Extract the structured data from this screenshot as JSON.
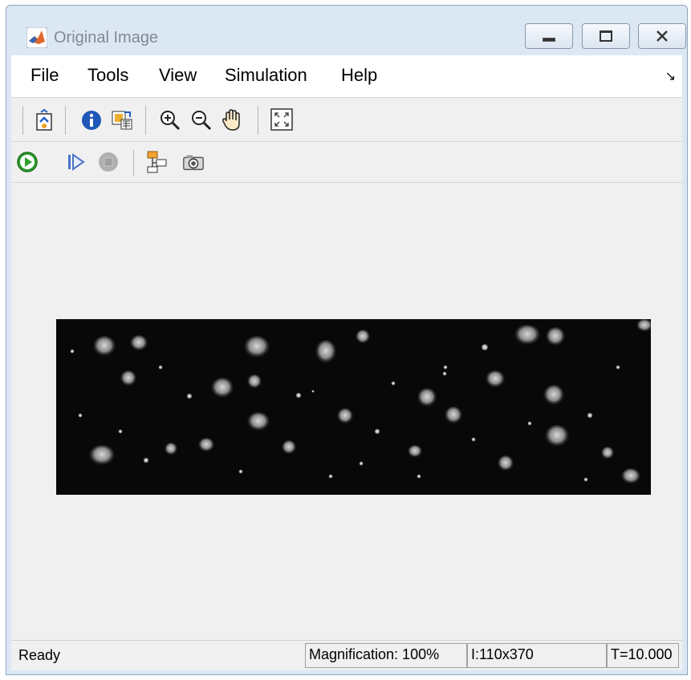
{
  "window": {
    "title": "Original Image",
    "controls": {
      "minimize": "minimize-icon",
      "maximize": "maximize-icon",
      "close": "close-icon"
    }
  },
  "menu": {
    "items": [
      {
        "label": "File"
      },
      {
        "label": "Tools"
      },
      {
        "label": "View"
      },
      {
        "label": "Simulation"
      },
      {
        "label": "Help"
      }
    ],
    "corner_glyph": "↘"
  },
  "toolbar1": {
    "buttons": [
      {
        "icon": "export-to-workspace-icon"
      },
      {
        "icon": "info-icon"
      },
      {
        "icon": "colormap-icon"
      },
      {
        "icon": "zoom-in-icon"
      },
      {
        "icon": "zoom-out-icon"
      },
      {
        "icon": "pan-hand-icon"
      },
      {
        "icon": "fit-to-window-icon"
      }
    ]
  },
  "toolbar2": {
    "buttons": [
      {
        "icon": "run-icon"
      },
      {
        "icon": "step-forward-icon"
      },
      {
        "icon": "stop-icon"
      },
      {
        "icon": "highlight-model-icon"
      },
      {
        "icon": "snapshot-icon"
      }
    ]
  },
  "status": {
    "state": "Ready",
    "magnification": "Magnification: 100%",
    "image_size": "I:110x370",
    "time": "T=10.000"
  },
  "colors": {
    "window_frame": "#dce7f4",
    "client_bg": "#f0f0f0",
    "image_bg": "#0a0a0a",
    "run_green": "#2e9e2e"
  }
}
